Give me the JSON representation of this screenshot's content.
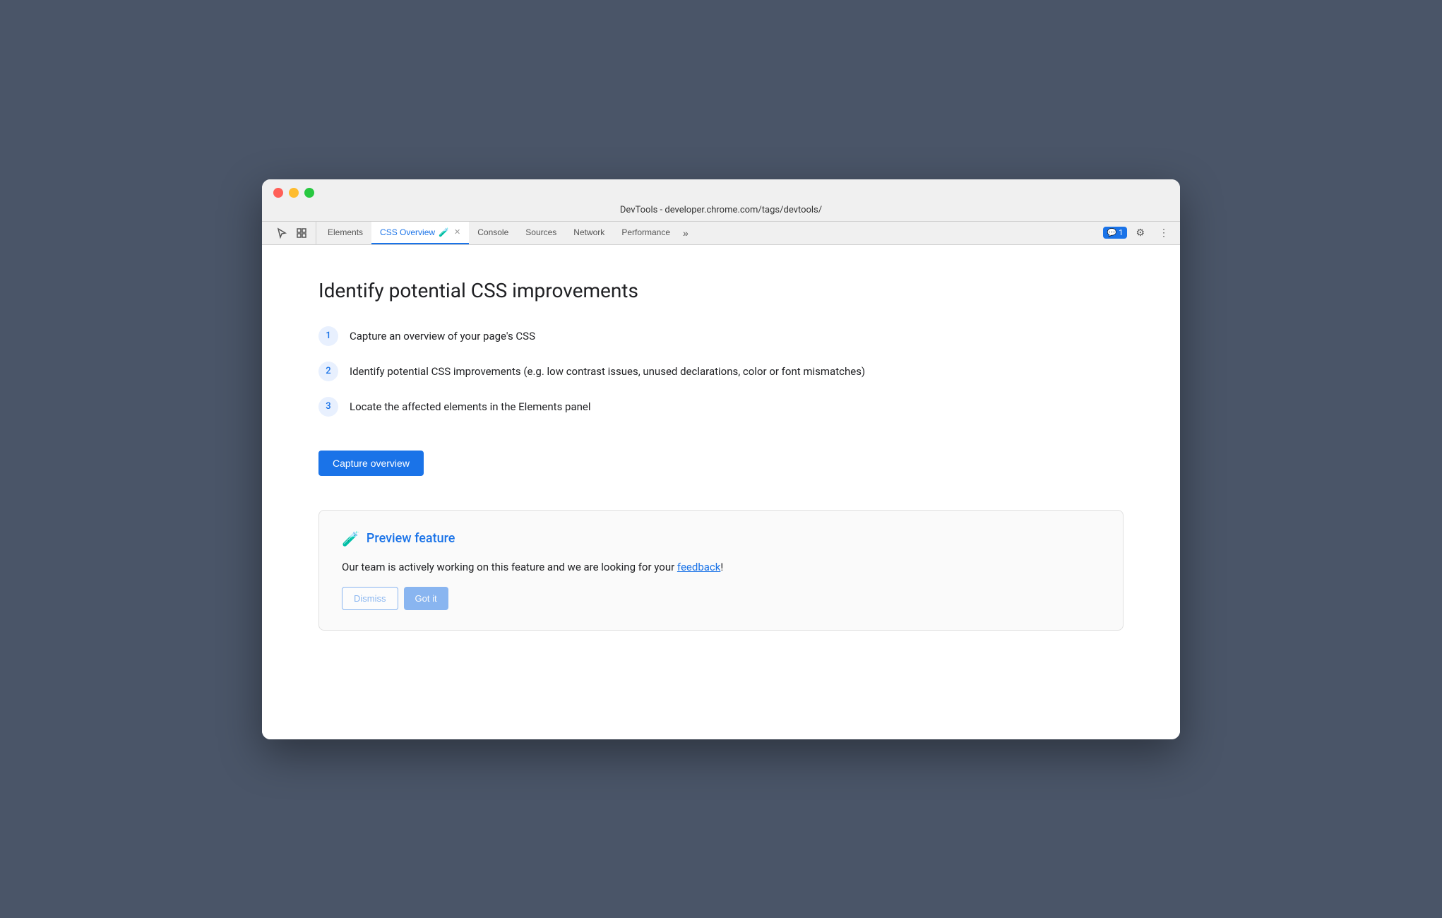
{
  "window": {
    "title": "DevTools - developer.chrome.com/tags/devtools/"
  },
  "tabs": {
    "items": [
      {
        "id": "elements",
        "label": "Elements",
        "active": false
      },
      {
        "id": "css-overview",
        "label": "CSS Overview",
        "active": true
      },
      {
        "id": "console",
        "label": "Console",
        "active": false
      },
      {
        "id": "sources",
        "label": "Sources",
        "active": false
      },
      {
        "id": "network",
        "label": "Network",
        "active": false
      },
      {
        "id": "performance",
        "label": "Performance",
        "active": false
      }
    ],
    "more_label": "»",
    "notification_count": "1",
    "settings_icon": "⚙",
    "more_options_icon": "⋮"
  },
  "main": {
    "heading": "Identify potential CSS improvements",
    "steps": [
      {
        "number": "1",
        "text": "Capture an overview of your page's CSS"
      },
      {
        "number": "2",
        "text": "Identify potential CSS improvements (e.g. low contrast issues, unused declarations, color or font mismatches)"
      },
      {
        "number": "3",
        "text": "Locate the affected elements in the Elements panel"
      }
    ],
    "capture_button_label": "Capture overview",
    "preview": {
      "icon": "🧪",
      "title": "Preview feature",
      "text": "Our team is actively working on this feature and we are looking for your ",
      "link_text": "feedback",
      "text_end": "!"
    }
  },
  "colors": {
    "accent": "#1a73e8",
    "step_bg": "#e8f0fe",
    "step_text": "#1a73e8"
  }
}
